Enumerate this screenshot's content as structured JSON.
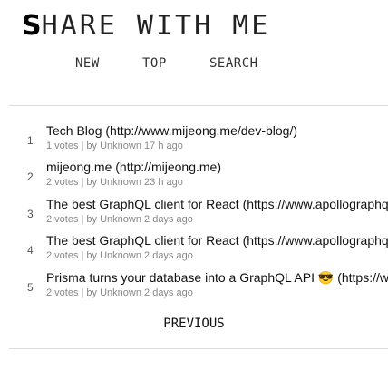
{
  "app": {
    "logo_first": "S",
    "logo_rest": "HARE WITH ME"
  },
  "nav": {
    "new": "NEW",
    "top": "TOP",
    "search": "SEARCH"
  },
  "links": [
    {
      "rank": "1",
      "title": "Tech Blog",
      "url": "(http://www.mijeong.me/dev-blog/)",
      "meta": "1 votes | by Unknown 17 h ago"
    },
    {
      "rank": "2",
      "title": "mijeong.me",
      "url": "(http://mijeong.me)",
      "meta": "2 votes | by Unknown 23 h ago"
    },
    {
      "rank": "3",
      "title": "The best GraphQL client for React",
      "url": "(https://www.apollographql.com)",
      "meta": "2 votes | by Unknown 2 days ago"
    },
    {
      "rank": "4",
      "title": "The best GraphQL client for React",
      "url": "(https://www.apollographql.com)",
      "meta": "2 votes | by Unknown 2 days ago"
    },
    {
      "rank": "5",
      "title": "Prisma turns your database into a GraphQL API 😎",
      "url": "(https://www.prisma.io)",
      "meta": "2 votes | by Unknown 2 days ago"
    }
  ],
  "pager": {
    "previous": "PREVIOUS"
  }
}
